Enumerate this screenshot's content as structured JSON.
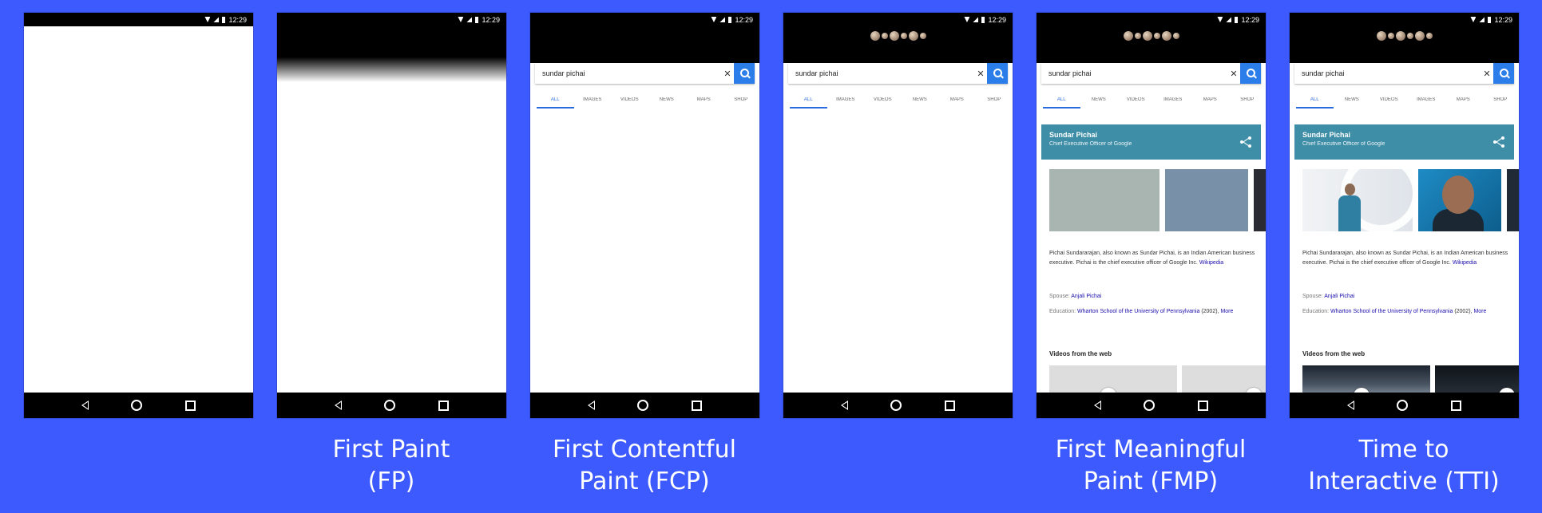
{
  "status_time": "12:29",
  "search": {
    "query": "sundar pichai",
    "clear_glyph": "✕"
  },
  "tabs_basic": [
    "ALL",
    "IMAGES",
    "VIDEOS",
    "NEWS",
    "MAPS",
    "SHOP"
  ],
  "tabs_results": [
    "ALL",
    "NEWS",
    "VIDEOS",
    "IMAGES",
    "MAPS",
    "SHOP"
  ],
  "knowledge_panel": {
    "name": "Sundar Pichai",
    "role": "Chief Executive Officer of Google",
    "desc": "Pichai Sundararajan, also known as Sundar Pichai, is an Indian American business executive. Pichai is the chief executive officer of Google Inc.",
    "desc_link": "Wikipedia",
    "spouse_label": "Spouse:",
    "spouse_value": "Anjali Pichai",
    "education_label": "Education:",
    "education_value": "Wharton School of the University of Pennsylvania",
    "education_year": "(2002),",
    "education_more": "More",
    "videos_title": "Videos from the web"
  },
  "captions": {
    "fp": [
      "First Paint",
      "(FP)"
    ],
    "fcp": [
      "First Contentful",
      "Paint (FCP)"
    ],
    "fmp": [
      "First Meaningful",
      "Paint (FMP)"
    ],
    "tti": [
      "Time to",
      "Interactive (TTI)"
    ]
  },
  "colors": {
    "background": "#3d5afe",
    "search_button": "#2b7de9",
    "panel_header": "#3f8ea7",
    "tab_active": "#2b6be0",
    "link": "#1a0dab"
  },
  "icons": [
    "wifi-icon",
    "signal-icon",
    "battery-icon",
    "search-icon",
    "clear-icon",
    "share-icon",
    "back-icon",
    "home-icon",
    "recents-icon",
    "play-icon"
  ]
}
